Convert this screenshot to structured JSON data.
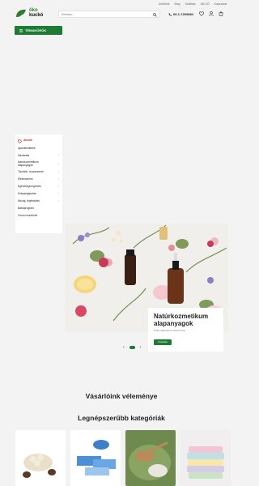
{
  "header": {
    "logo_line1": "öko",
    "logo_line2": "kuckó",
    "links": [
      "Üzletünk",
      "Blog",
      "Szállítás",
      "AKCIÓ",
      "Kapcsolat"
    ],
    "search_placeholder": "Keresés...",
    "phone": "06-1-7200884",
    "topics_label": "TÉMAKÖRÖK"
  },
  "sidebar": {
    "items": [
      {
        "label": "Akciók"
      },
      {
        "label": "Ajándékötletek"
      },
      {
        "label": "Háztartás"
      },
      {
        "label": "Natúrkozmetikum alapanyagok"
      },
      {
        "label": "Tisztítók, mosószerek"
      },
      {
        "label": "Élelmiszerek"
      },
      {
        "label": "Egészségmegőrzés"
      },
      {
        "label": "Szépségápolás"
      },
      {
        "label": "Illóolaj, légfrissítés"
      },
      {
        "label": "Babaprogram"
      },
      {
        "label": "Orvosi eszközök"
      }
    ]
  },
  "hero": {
    "title": "Natúrkozmetikum alapanyagok",
    "subtitle": "Óriási választék és kiskurzusok",
    "button": "Vásárlás"
  },
  "sections": {
    "reviews_title": "Vásárlóink véleménye",
    "categories_title": "Legnépszerűbb kategóriák"
  },
  "colors": {
    "brand_green": "#1e7b34",
    "sale_red": "#c62828"
  }
}
